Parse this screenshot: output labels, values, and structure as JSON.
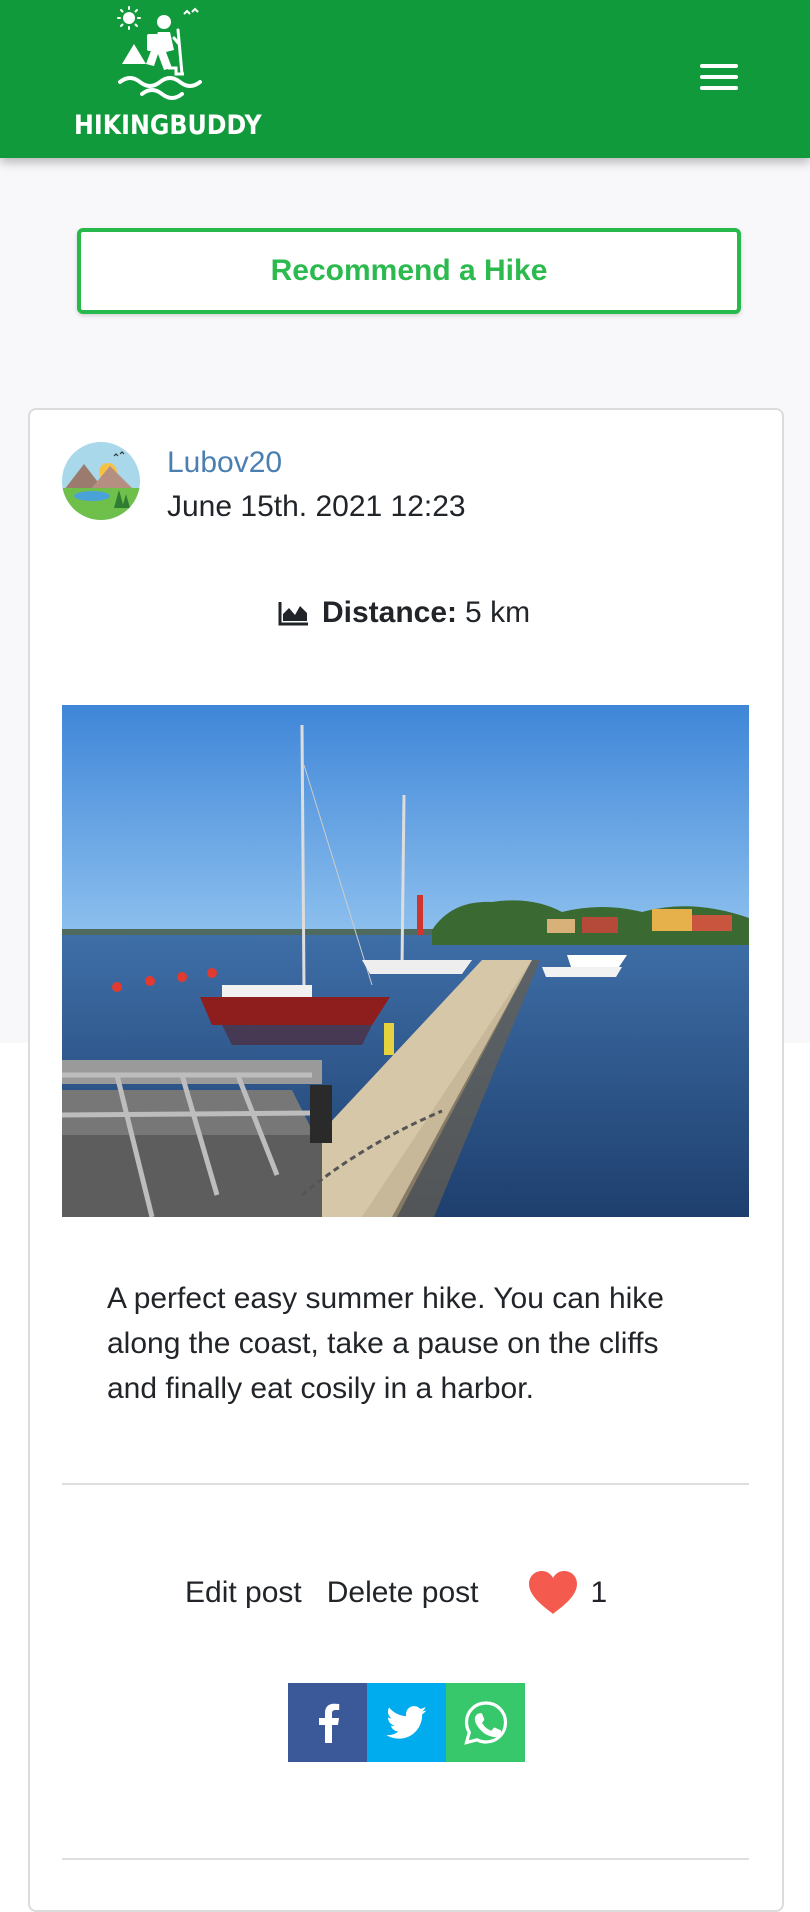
{
  "header": {
    "logo_text": "HIKINGBUDDY",
    "brand_color": "#119a3b",
    "menu_icon": "hamburger-icon"
  },
  "recommend_button": {
    "label": "Recommend a Hike",
    "color": "#2cba4f"
  },
  "post": {
    "username": "Lubov20",
    "date": "June 15th. 2021 12:23",
    "distance_label": "Distance:",
    "distance_value": "5 km",
    "distance_icon": "area-chart-icon",
    "image": "harbor-pier-photo",
    "description": "A perfect easy summer hike. You can hike along the coast, take a pause on the cliffs and finally eat cosily in a harbor.",
    "actions": {
      "edit": "Edit post",
      "delete": "Delete post",
      "like_count": "1",
      "like_icon": "heart-icon"
    },
    "share": [
      {
        "name": "facebook-icon",
        "color": "#3b5998"
      },
      {
        "name": "twitter-icon",
        "color": "#00aced"
      },
      {
        "name": "whatsapp-icon",
        "color": "#25d366"
      }
    ]
  }
}
